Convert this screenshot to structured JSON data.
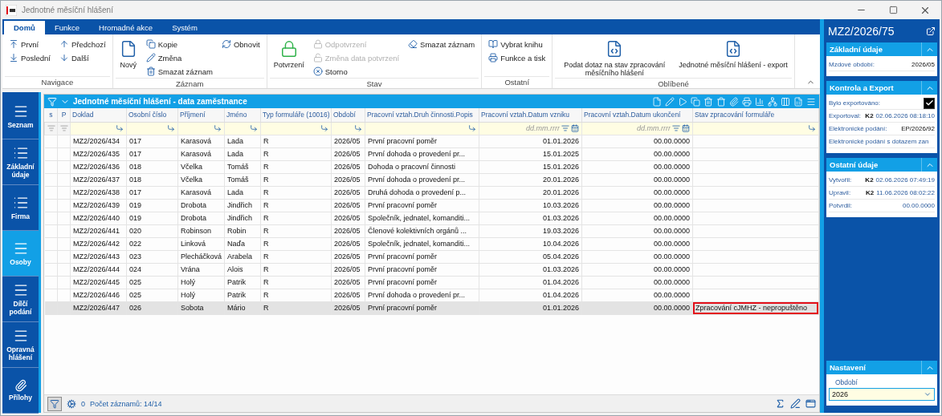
{
  "window": {
    "title": "Jednotné měsíční hlášení"
  },
  "ribbon": {
    "tabs": [
      {
        "label": "Domů",
        "selected": true
      },
      {
        "label": "Funkce",
        "selected": false
      },
      {
        "label": "Hromadné akce",
        "selected": false
      },
      {
        "label": "Systém",
        "selected": false
      }
    ],
    "groups": [
      {
        "label": "Navigace",
        "columns": [
          [
            {
              "label": "První",
              "kind": "small",
              "disabled": false
            },
            {
              "label": "Poslední",
              "kind": "small",
              "disabled": false
            }
          ],
          [
            {
              "label": "Předchozí",
              "kind": "small",
              "disabled": false
            },
            {
              "label": "Další",
              "kind": "small",
              "disabled": false
            }
          ]
        ]
      },
      {
        "label": "Záznam",
        "columns": [
          [
            {
              "label": "Nový",
              "kind": "large",
              "disabled": false
            }
          ],
          [
            {
              "label": "Kopie",
              "kind": "small",
              "disabled": false
            },
            {
              "label": "Změna",
              "kind": "small",
              "disabled": false
            },
            {
              "label": "Smazat záznam",
              "kind": "small",
              "disabled": false
            }
          ],
          [
            {
              "label": "Obnovit",
              "kind": "small",
              "disabled": false
            }
          ]
        ]
      },
      {
        "label": "Stav",
        "columns": [
          [
            {
              "label": "Potvrzení",
              "kind": "large",
              "disabled": false
            }
          ],
          [
            {
              "label": "Odpotvrzení",
              "kind": "small",
              "disabled": true
            },
            {
              "label": "Změna data potvrzení",
              "kind": "small",
              "disabled": true
            },
            {
              "label": "Storno",
              "kind": "small",
              "disabled": false
            }
          ],
          [
            {
              "label": "Smazat záznam",
              "kind": "small",
              "disabled": false
            }
          ]
        ]
      },
      {
        "label": "Ostatní",
        "columns": [
          [
            {
              "label": "Vybrat knihu",
              "kind": "small",
              "disabled": false
            },
            {
              "label": "Funkce a tisk",
              "kind": "small",
              "disabled": false
            }
          ]
        ]
      },
      {
        "label": "Oblíbené",
        "columns": [
          [
            {
              "label": "Podat dotaz na stav zpracování měsíčního hlášení",
              "kind": "large",
              "disabled": false
            }
          ],
          [
            {
              "label": "Jednotné měsíční hlášení - export",
              "kind": "large",
              "disabled": false
            }
          ]
        ]
      }
    ]
  },
  "nav": {
    "items": [
      {
        "label": "Seznam",
        "kind": "menu",
        "selected": false
      },
      {
        "label": "Základní údaje",
        "kind": "list",
        "selected": false
      },
      {
        "label": "Firma",
        "kind": "list",
        "selected": false
      },
      {
        "label": "Osoby",
        "kind": "menu",
        "selected": true
      },
      {
        "label": "Dílčí podání",
        "kind": "menu",
        "selected": false
      },
      {
        "label": "Opravná hlášení",
        "kind": "menu",
        "selected": false
      },
      {
        "label": "Přílohy",
        "kind": "attachment",
        "selected": false
      }
    ]
  },
  "grid": {
    "title": "Jednotné měsíční hlášení - data zaměstnance",
    "columns": [
      {
        "label": "s",
        "kind": "marker"
      },
      {
        "label": "P",
        "kind": "marker"
      },
      {
        "label": "Doklad",
        "kind": "text"
      },
      {
        "label": "Osobní číslo",
        "kind": "text"
      },
      {
        "label": "Příjmení",
        "kind": "text"
      },
      {
        "label": "Jméno",
        "kind": "text"
      },
      {
        "label": "Typ formuláře (10016)",
        "kind": "text"
      },
      {
        "label": "Období",
        "kind": "text"
      },
      {
        "label": "Pracovní vztah.Druh činnosti.Popis",
        "kind": "text"
      },
      {
        "label": "Pracovní vztah.Datum vzniku",
        "kind": "date",
        "placeholder": "dd.mm.rrrr"
      },
      {
        "label": "Pracovní vztah.Datum ukončení",
        "kind": "date",
        "placeholder": "dd.mm.rrrr"
      },
      {
        "label": "Stav zpracování formuláře",
        "kind": "text"
      }
    ],
    "rows": [
      {
        "selected": false,
        "status_flagged": false,
        "cells": [
          "",
          "",
          "MZ2/2026/434",
          "017",
          "Karasová",
          "Lada",
          "R",
          "2026/05",
          "První pracovní poměr",
          "01.01.2026",
          "00.00.0000",
          ""
        ]
      },
      {
        "selected": false,
        "status_flagged": false,
        "cells": [
          "",
          "",
          "MZ2/2026/435",
          "017",
          "Karasová",
          "Lada",
          "R",
          "2026/05",
          "První dohoda o provedení pr...",
          "15.01.2025",
          "00.00.0000",
          ""
        ]
      },
      {
        "selected": false,
        "status_flagged": false,
        "cells": [
          "",
          "",
          "MZ2/2026/436",
          "018",
          "Včelka",
          "Tomáš",
          "R",
          "2026/05",
          "Dohoda o pracovní činnosti",
          "15.01.2026",
          "00.00.0000",
          ""
        ]
      },
      {
        "selected": false,
        "status_flagged": false,
        "cells": [
          "",
          "",
          "MZ2/2026/437",
          "018",
          "Včelka",
          "Tomáš",
          "R",
          "2026/05",
          "První dohoda o provedení pr...",
          "20.01.2026",
          "00.00.0000",
          ""
        ]
      },
      {
        "selected": false,
        "status_flagged": false,
        "cells": [
          "",
          "",
          "MZ2/2026/438",
          "017",
          "Karasová",
          "Lada",
          "R",
          "2026/05",
          "Druhá dohoda o provedení p...",
          "20.01.2026",
          "00.00.0000",
          ""
        ]
      },
      {
        "selected": false,
        "status_flagged": false,
        "cells": [
          "",
          "",
          "MZ2/2026/439",
          "019",
          "Drobota",
          "Jindřich",
          "R",
          "2026/05",
          "První pracovní poměr",
          "10.03.2026",
          "00.00.0000",
          ""
        ]
      },
      {
        "selected": false,
        "status_flagged": false,
        "cells": [
          "",
          "",
          "MZ2/2026/440",
          "019",
          "Drobota",
          "Jindřich",
          "R",
          "2026/05",
          "Společník, jednatel, komanditi...",
          "01.03.2026",
          "00.00.0000",
          ""
        ]
      },
      {
        "selected": false,
        "status_flagged": false,
        "cells": [
          "",
          "",
          "MZ2/2026/441",
          "020",
          "Robinson",
          "Robin",
          "R",
          "2026/05",
          "Členové kolektivních orgánů ...",
          "19.03.2026",
          "00.00.0000",
          ""
        ]
      },
      {
        "selected": false,
        "status_flagged": false,
        "cells": [
          "",
          "",
          "MZ2/2026/442",
          "022",
          "Linková",
          "Naďa",
          "R",
          "2026/05",
          "Společník, jednatel, komanditi...",
          "10.04.2026",
          "00.00.0000",
          ""
        ]
      },
      {
        "selected": false,
        "status_flagged": false,
        "cells": [
          "",
          "",
          "MZ2/2026/443",
          "023",
          "Plecháčková",
          "Arabela",
          "R",
          "2026/05",
          "První pracovní poměr",
          "05.04.2026",
          "00.00.0000",
          ""
        ]
      },
      {
        "selected": false,
        "status_flagged": false,
        "cells": [
          "",
          "",
          "MZ2/2026/444",
          "024",
          "Vrána",
          "Alois",
          "R",
          "2026/05",
          "První pracovní poměr",
          "01.03.2026",
          "00.00.0000",
          ""
        ]
      },
      {
        "selected": false,
        "status_flagged": false,
        "cells": [
          "",
          "",
          "MZ2/2026/445",
          "025",
          "Holý",
          "Patrik",
          "R",
          "2026/05",
          "První pracovní poměr",
          "01.04.2026",
          "00.00.0000",
          ""
        ]
      },
      {
        "selected": false,
        "status_flagged": false,
        "cells": [
          "",
          "",
          "MZ2/2026/446",
          "025",
          "Holý",
          "Patrik",
          "R",
          "2026/05",
          "První dohoda o provedení pr...",
          "01.04.2026",
          "00.00.0000",
          ""
        ]
      },
      {
        "selected": true,
        "status_flagged": true,
        "cells": [
          "",
          "",
          "MZ2/2026/447",
          "026",
          "Sobota",
          "Mário",
          "R",
          "2026/05",
          "První pracovní poměr",
          "01.01.2026",
          "00.00.0000",
          "Zpracování cJMHZ - nepropuštěno"
        ]
      }
    ],
    "footer": {
      "filtered": "0",
      "count": "Počet záznamů: 14/14"
    }
  },
  "detail": {
    "record": "MZ2/2026/75",
    "sections": [
      {
        "title": "Základní údaje",
        "expanded": true,
        "fields": [
          {
            "kind": "text",
            "label": "Mzdové období:",
            "value": "2026/05"
          }
        ]
      },
      {
        "title": "Kontrola a Export",
        "expanded": true,
        "fields": [
          {
            "kind": "checkbox",
            "label": "Bylo exportováno:",
            "checked": true
          },
          {
            "kind": "user",
            "label": "Exportoval:",
            "user": "K2",
            "value": "02.06.2026 08:18:10"
          },
          {
            "kind": "text",
            "label": "Elektronické podání:",
            "value": "EP/2026/92"
          },
          {
            "kind": "link",
            "label": "Elektronické podání s dotazem zan"
          }
        ]
      },
      {
        "title": "Ostatní údaje",
        "expanded": true,
        "fields": [
          {
            "kind": "user",
            "label": "Vytvořil:",
            "user": "K2",
            "value": "02.06.2026 07:49:19"
          },
          {
            "kind": "user",
            "label": "Upravil:",
            "user": "K2",
            "value": "11.06.2026 08:02:22"
          },
          {
            "kind": "date",
            "label": "Potvrdil:",
            "value": "00.00.0000"
          }
        ]
      }
    ],
    "settings": {
      "title": "Nastavení",
      "expanded": true,
      "field_label": "Období",
      "value": "2026"
    }
  }
}
